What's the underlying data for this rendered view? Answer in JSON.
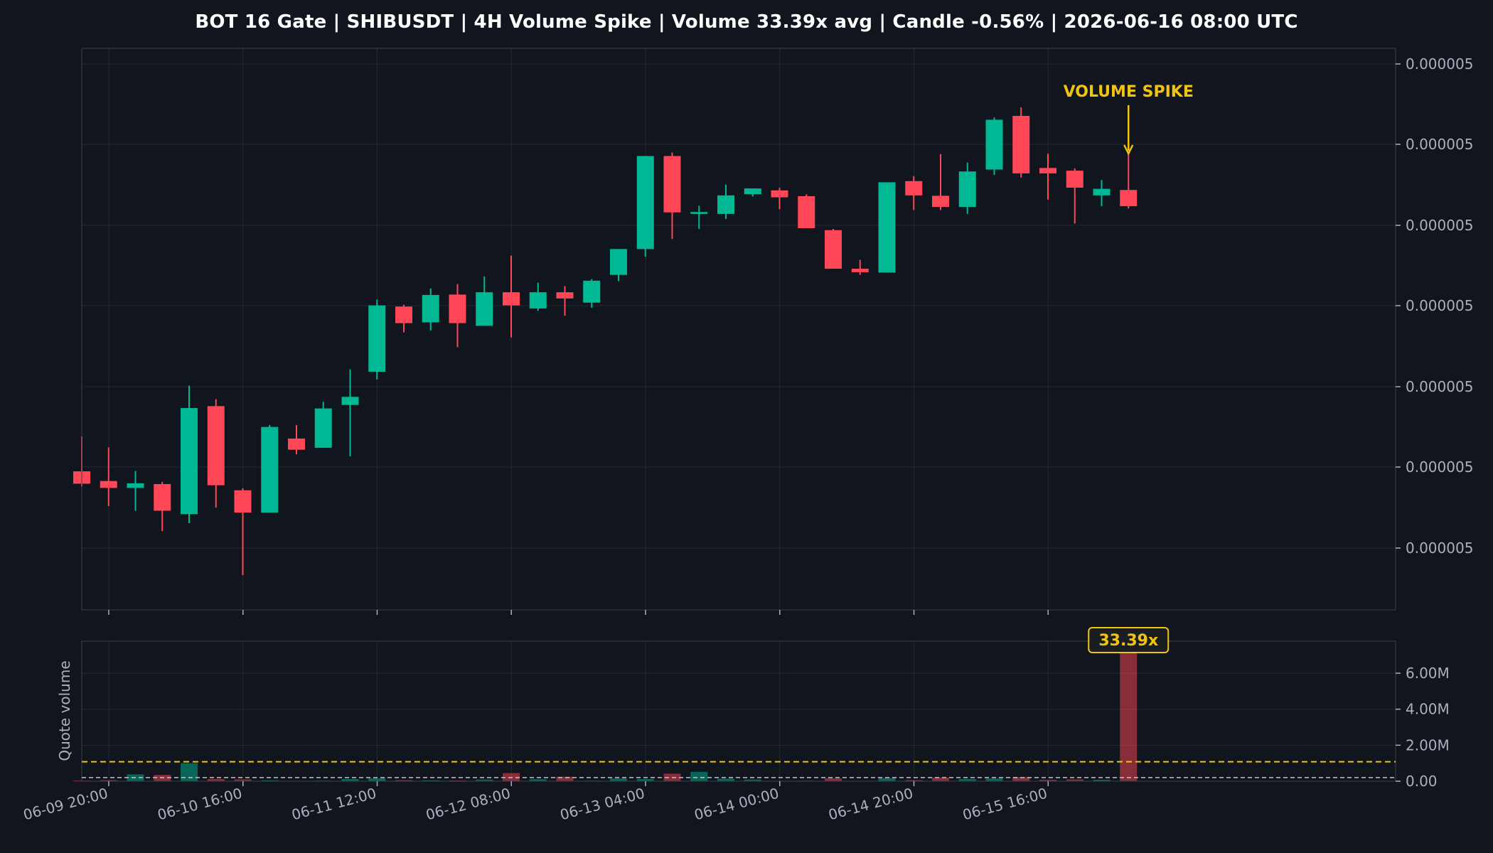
{
  "title": "BOT 16 Gate | SHIBUSDT | 4H Volume Spike | Volume 33.39x avg | Candle -0.56% | 2026-06-16 08:00 UTC",
  "colors": {
    "background": "#11151d",
    "up": "#00b894",
    "down": "#ff4757",
    "accent": "#f1c40f",
    "grid": "#222832",
    "axis_text": "#aab1bd"
  },
  "chart_data": [
    {
      "type": "candlestick",
      "symbol": "SHIBUSDT",
      "interval": "4H",
      "ylabel": "",
      "y_tick_labels": [
        "0.000005",
        "0.000005",
        "0.000005",
        "0.000005",
        "0.000005",
        "0.000005",
        "0.000005"
      ],
      "x_tick_labels": [
        "06-09 20:00",
        "06-10 16:00",
        "06-11 12:00",
        "06-12 08:00",
        "06-13 04:00",
        "06-14 00:00",
        "06-14 20:00",
        "06-15 16:00"
      ],
      "grid": true,
      "candles": [
        {
          "t": "06-09 20:00",
          "o": 50.68,
          "h": 52.48,
          "l": 49.9,
          "c": 50.04
        },
        {
          "t": "06-10 00:00",
          "o": 50.18,
          "h": 51.92,
          "l": 48.88,
          "c": 49.82
        },
        {
          "t": "06-10 04:00",
          "o": 49.82,
          "h": 50.7,
          "l": 48.64,
          "c": 50.06
        },
        {
          "t": "06-10 08:00",
          "o": 50.02,
          "h": 50.14,
          "l": 47.58,
          "c": 48.64
        },
        {
          "t": "06-10 12:00",
          "o": 48.46,
          "h": 55.12,
          "l": 48.0,
          "c": 53.96
        },
        {
          "t": "06-10 16:00",
          "o": 54.06,
          "h": 54.42,
          "l": 48.8,
          "c": 49.96
        },
        {
          "t": "06-10 20:00",
          "o": 49.7,
          "h": 49.8,
          "l": 45.3,
          "c": 48.54
        },
        {
          "t": "06-11 00:00",
          "o": 48.54,
          "h": 53.08,
          "l": 48.54,
          "c": 52.98
        },
        {
          "t": "06-11 04:00",
          "o": 52.38,
          "h": 53.08,
          "l": 51.56,
          "c": 51.8
        },
        {
          "t": "06-11 08:00",
          "o": 51.9,
          "h": 54.28,
          "l": 51.9,
          "c": 53.94
        },
        {
          "t": "06-11 12:00",
          "o": 54.12,
          "h": 55.96,
          "l": 51.46,
          "c": 54.54
        },
        {
          "t": "06-11 16:00",
          "o": 55.84,
          "h": 59.58,
          "l": 55.44,
          "c": 59.28
        },
        {
          "t": "06-11 20:00",
          "o": 59.22,
          "h": 59.32,
          "l": 57.88,
          "c": 58.36
        },
        {
          "t": "06-12 00:00",
          "o": 58.4,
          "h": 60.16,
          "l": 57.98,
          "c": 59.82
        },
        {
          "t": "06-12 04:00",
          "o": 59.84,
          "h": 60.38,
          "l": 57.12,
          "c": 58.36
        },
        {
          "t": "06-12 08:00",
          "o": 58.22,
          "h": 60.78,
          "l": 58.22,
          "c": 59.96
        },
        {
          "t": "06-12 12:00",
          "o": 59.96,
          "h": 61.86,
          "l": 57.62,
          "c": 59.28
        },
        {
          "t": "06-12 16:00",
          "o": 59.12,
          "h": 60.46,
          "l": 59.0,
          "c": 59.96
        },
        {
          "t": "06-12 20:00",
          "o": 59.96,
          "h": 60.28,
          "l": 58.74,
          "c": 59.64
        },
        {
          "t": "06-13 00:00",
          "o": 59.42,
          "h": 60.64,
          "l": 59.16,
          "c": 60.56
        },
        {
          "t": "06-13 04:00",
          "o": 60.86,
          "h": 61.42,
          "l": 60.54,
          "c": 62.2
        },
        {
          "t": "06-13 08:00",
          "o": 62.2,
          "h": 62.6,
          "l": 61.8,
          "c": 67.02
        },
        {
          "t": "06-13 12:00",
          "o": 67.02,
          "h": 67.2,
          "l": 62.72,
          "c": 64.1
        },
        {
          "t": "06-13 16:00",
          "o": 64.02,
          "h": 64.44,
          "l": 63.24,
          "c": 64.12
        },
        {
          "t": "06-13 20:00",
          "o": 64.02,
          "h": 65.54,
          "l": 63.76,
          "c": 64.98
        },
        {
          "t": "06-14 00:00",
          "o": 65.04,
          "h": 65.34,
          "l": 64.92,
          "c": 65.34
        },
        {
          "t": "06-14 04:00",
          "o": 65.24,
          "h": 65.38,
          "l": 64.26,
          "c": 64.88
        },
        {
          "t": "06-14 08:00",
          "o": 64.94,
          "h": 65.04,
          "l": 63.98,
          "c": 63.28
        },
        {
          "t": "06-14 12:00",
          "o": 63.18,
          "h": 63.24,
          "l": 62.32,
          "c": 61.18
        },
        {
          "t": "06-14 16:00",
          "o": 61.18,
          "h": 61.64,
          "l": 60.86,
          "c": 61.0
        },
        {
          "t": "06-14 20:00",
          "o": 60.98,
          "h": 65.66,
          "l": 60.98,
          "c": 65.66
        },
        {
          "t": "06-15 00:00",
          "o": 65.72,
          "h": 65.98,
          "l": 64.22,
          "c": 64.98
        },
        {
          "t": "06-15 04:00",
          "o": 64.96,
          "h": 67.12,
          "l": 64.22,
          "c": 64.38
        },
        {
          "t": "06-15 08:00",
          "o": 64.38,
          "h": 66.68,
          "l": 64.02,
          "c": 66.22
        },
        {
          "t": "06-15 12:00",
          "o": 66.32,
          "h": 69.02,
          "l": 66.04,
          "c": 68.9
        },
        {
          "t": "06-15 16:00",
          "o": 69.1,
          "h": 69.54,
          "l": 65.9,
          "c": 66.12
        },
        {
          "t": "06-15 20:00",
          "o": 66.4,
          "h": 67.14,
          "l": 64.76,
          "c": 66.12
        },
        {
          "t": "06-16 00:00",
          "o": 66.26,
          "h": 66.38,
          "l": 63.52,
          "c": 65.38
        },
        {
          "t": "06-16 04:00",
          "o": 64.98,
          "h": 65.78,
          "l": 64.42,
          "c": 65.32
        },
        {
          "t": "06-16 08:00",
          "o": 65.26,
          "h": 67.12,
          "l": 64.3,
          "c": 64.42
        }
      ],
      "annotation": {
        "text": "VOLUME SPIKE",
        "candle_index": 39
      }
    },
    {
      "type": "bar",
      "ylabel": "Quote volume",
      "ylim": [
        0,
        7700000
      ],
      "y_ticks": [
        0,
        2000000,
        4000000,
        6000000
      ],
      "y_tick_labels": [
        "0.00",
        "2.00M",
        "4.00M",
        "6.00M"
      ],
      "grid": true,
      "values": [
        30000,
        60000,
        380000,
        350000,
        1000000,
        120000,
        100000,
        50000,
        20000,
        30000,
        120000,
        160000,
        60000,
        50000,
        40000,
        90000,
        450000,
        110000,
        250000,
        30000,
        150000,
        120000,
        420000,
        520000,
        140000,
        90000,
        20000,
        30000,
        160000,
        20000,
        170000,
        60000,
        200000,
        120000,
        150000,
        230000,
        80000,
        100000,
        80000,
        7700000
      ],
      "avg_line": 1080000,
      "baseline_line": 200000,
      "spike_label": "33.39x"
    }
  ]
}
